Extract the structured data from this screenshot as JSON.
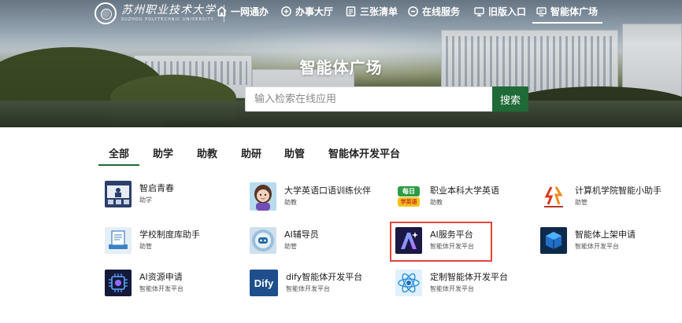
{
  "header": {
    "logo_text": "苏州职业技术大学",
    "logo_subtext": "SUZHOU POLYTECHNIC UNIVERSITY",
    "nav": [
      {
        "label": "一网通办",
        "icon": "home-icon"
      },
      {
        "label": "办事大厅",
        "icon": "grid-icon"
      },
      {
        "label": "三张清单",
        "icon": "list-icon"
      },
      {
        "label": "在线服务",
        "icon": "chat-icon"
      },
      {
        "label": "旧版入口",
        "icon": "monitor-icon"
      },
      {
        "label": "智能体广场",
        "icon": "screen-icon",
        "active": true
      }
    ]
  },
  "hero": {
    "title": "智能体广场",
    "search_placeholder": "输入检索在线应用",
    "search_button": "搜索"
  },
  "tabs": [
    {
      "label": "全部",
      "active": true
    },
    {
      "label": "助学"
    },
    {
      "label": "助教"
    },
    {
      "label": "助研"
    },
    {
      "label": "助管"
    },
    {
      "label": "智能体开发平台"
    }
  ],
  "apps": [
    {
      "name": "智启青春",
      "category": "助学",
      "icon": "classroom-icon"
    },
    {
      "name": "大学英语口语训练伙伴",
      "category": "助教",
      "icon": "avatar-girl-icon"
    },
    {
      "name": "职业本科大学英语",
      "category": "助教",
      "icon": "daily-english-icon",
      "icon_text": [
        "每日",
        "学英语"
      ]
    },
    {
      "name": "计算机学院智能小助手",
      "category": "助管",
      "icon": "college-logo-icon"
    },
    {
      "name": "学校制度库助手",
      "category": "助管",
      "icon": "document-book-icon"
    },
    {
      "name": "AI辅导员",
      "category": "助管",
      "icon": "robot-face-icon"
    },
    {
      "name": "AI服务平台",
      "category": "智能体开发平台",
      "icon": "ai-star-icon",
      "highlighted": true
    },
    {
      "name": "智能体上架申请",
      "category": "智能体开发平台",
      "icon": "cube-upload-icon"
    },
    {
      "name": "AI资源申请",
      "category": "智能体开发平台",
      "icon": "ai-chip-icon"
    },
    {
      "name": "dify智能体开发平台",
      "category": "智能体开发平台",
      "icon": "dify-logo-icon",
      "icon_text": "Dify"
    },
    {
      "name": "定制智能体开发平台",
      "category": "智能体开发平台",
      "icon": "atom-icon"
    }
  ],
  "colors": {
    "accent_green": "#1f6a37",
    "highlight_red": "#e0473e"
  }
}
